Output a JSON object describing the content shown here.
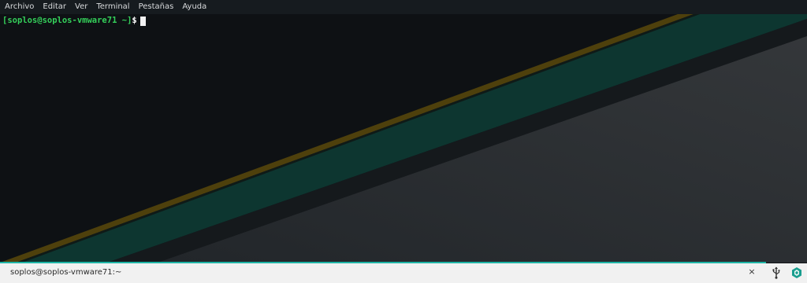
{
  "menubar": {
    "items": [
      {
        "label": "Archivo"
      },
      {
        "label": "Editar"
      },
      {
        "label": "Ver"
      },
      {
        "label": "Terminal"
      },
      {
        "label": "Pestañas"
      },
      {
        "label": "Ayuda"
      }
    ]
  },
  "terminal": {
    "prompt_open": "[",
    "prompt_user_host": "soplos@soplos-vmware71",
    "prompt_dir": "~",
    "prompt_close": "]",
    "prompt_sign": "$"
  },
  "taskbar": {
    "window_title": "soplos@soplos-vmware71:~",
    "close_glyph": "×"
  },
  "tray": {
    "usb_icon": "usb-icon",
    "update_icon": "update-notifier-icon"
  },
  "colors": {
    "accent_teal": "#1fb5a6",
    "prompt_green": "#34d05a",
    "stripe_yellow": "#5c4a0a",
    "stripe_teal": "#0f3a33"
  }
}
